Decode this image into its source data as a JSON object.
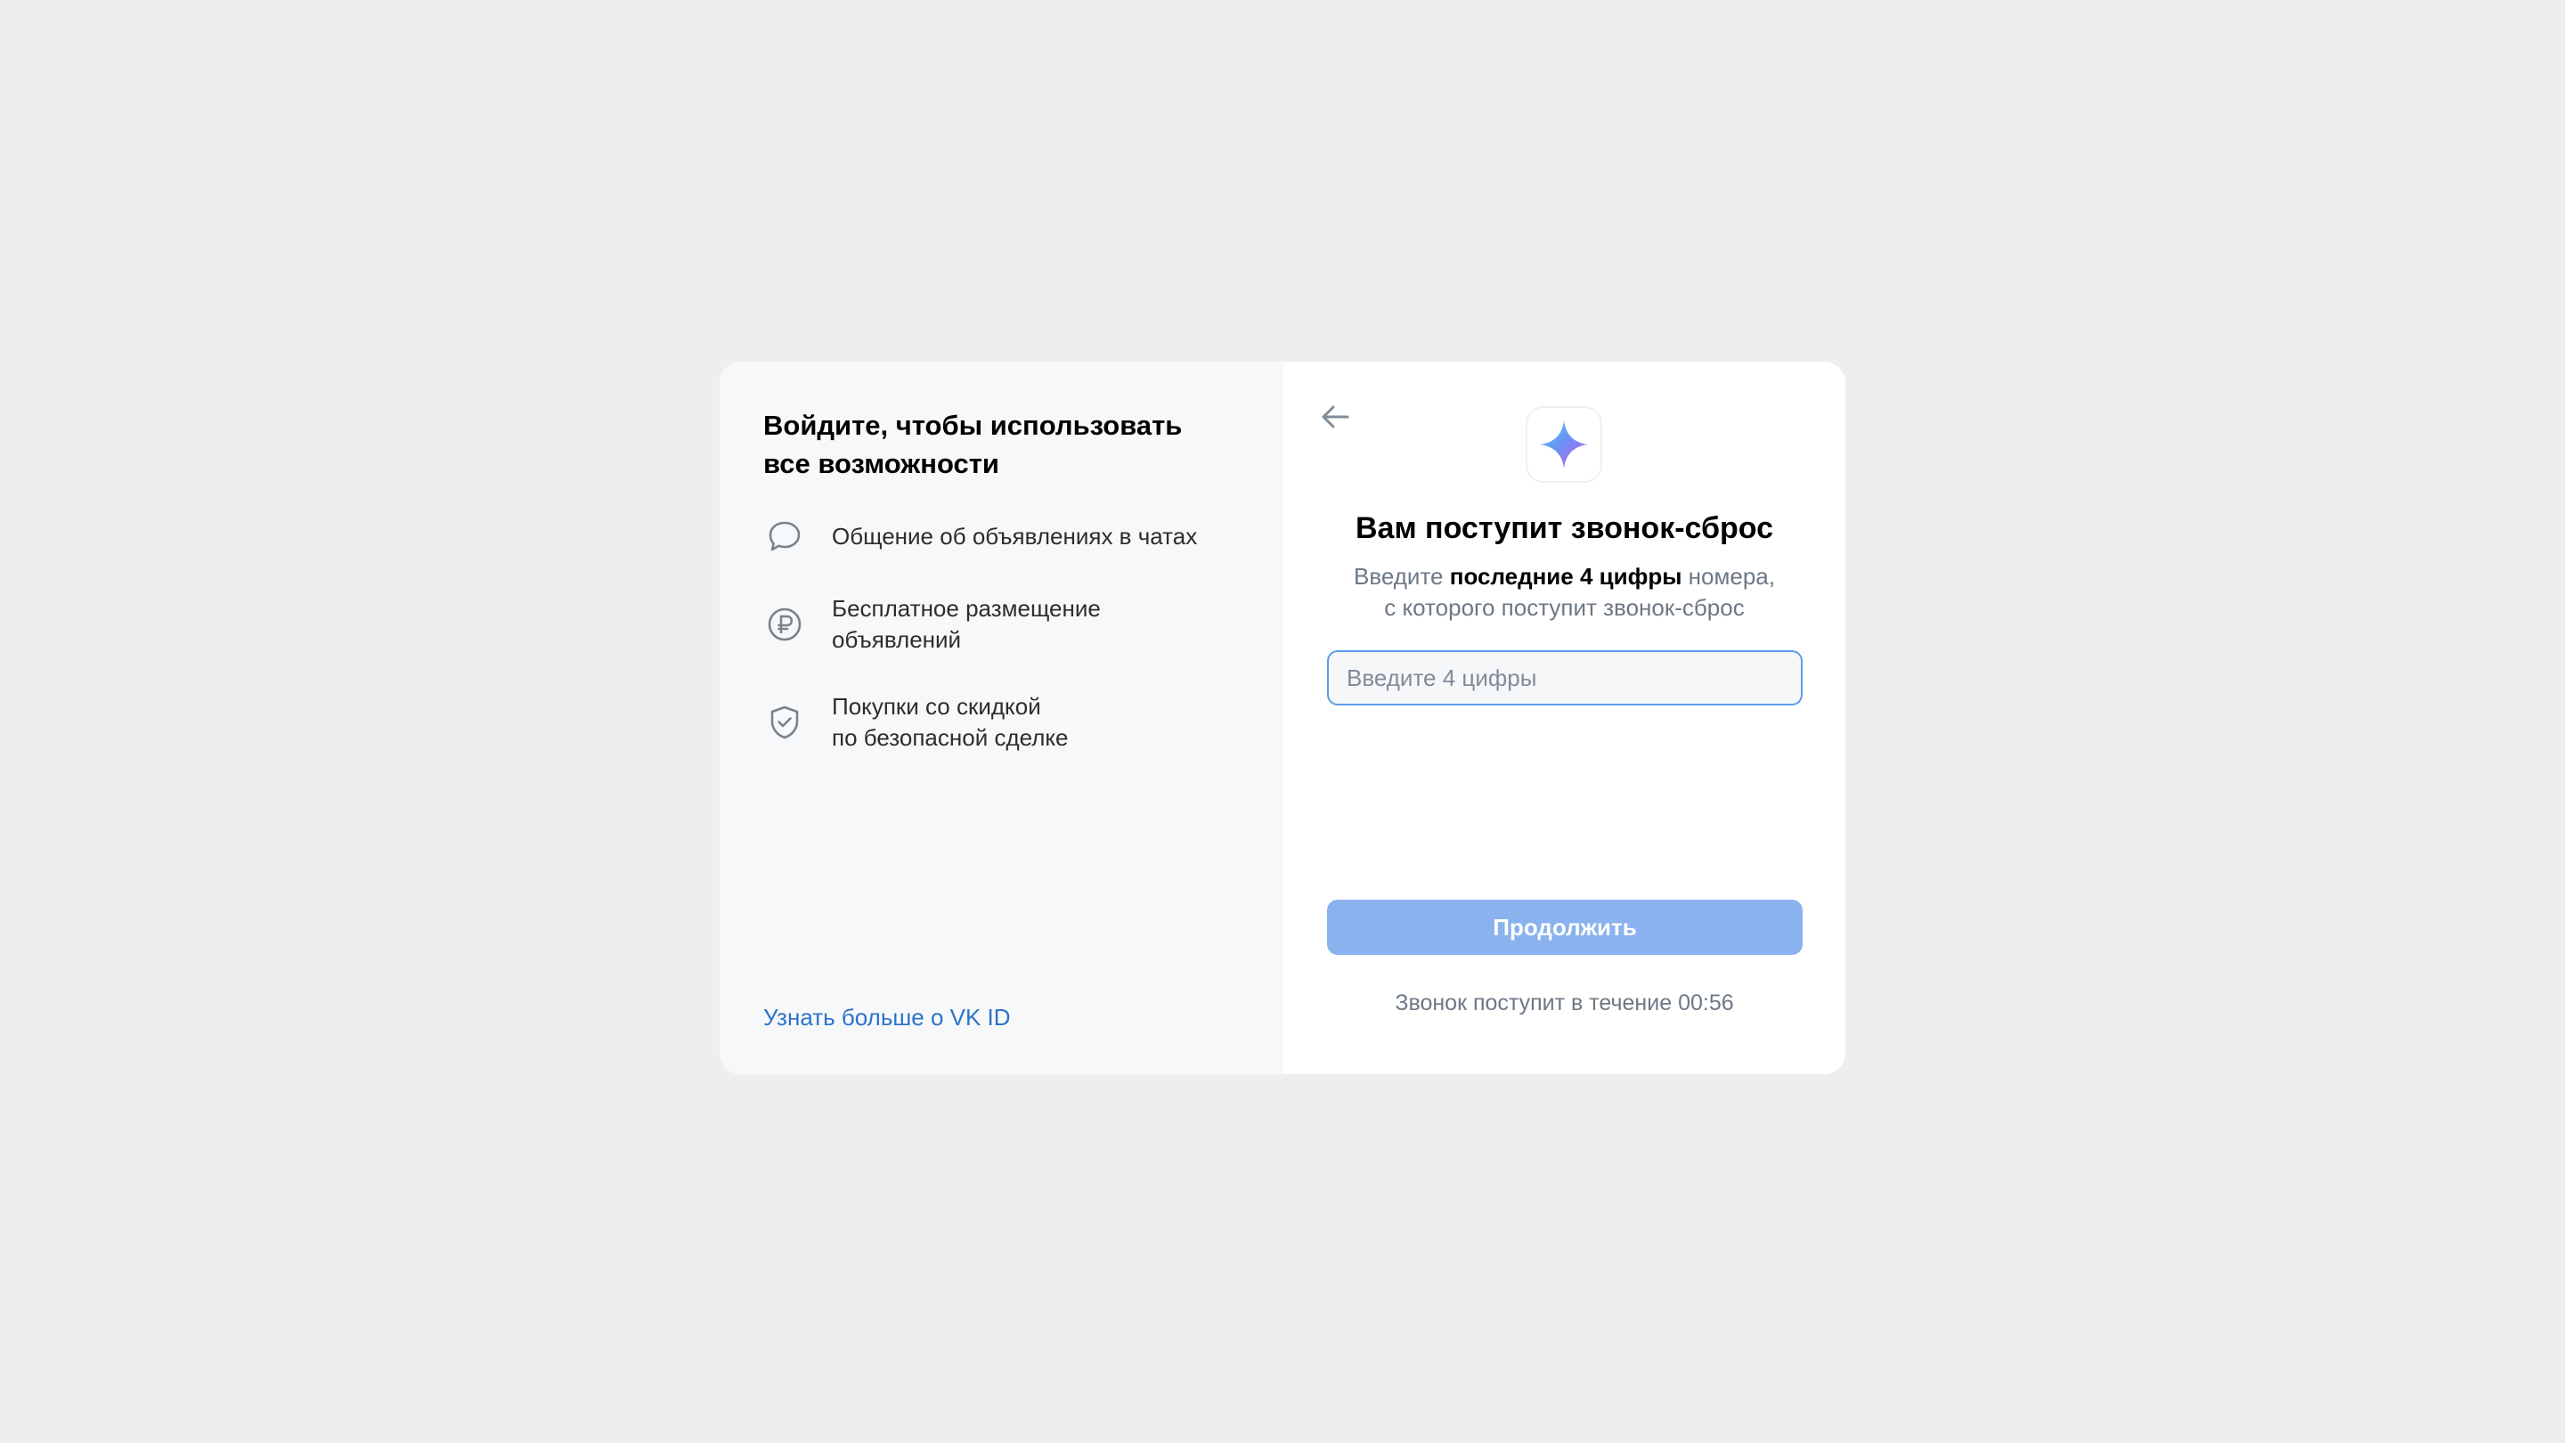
{
  "left_panel": {
    "title": "Войдите, чтобы использовать все возможности",
    "features": [
      {
        "icon": "chat-bubble-icon",
        "text": "Общение об объявлениях в чатах"
      },
      {
        "icon": "ruble-coin-icon",
        "text": "Бесплатное размещение\nобъявлений"
      },
      {
        "icon": "shield-check-icon",
        "text": "Покупки со скидкой\nпо безопасной сделке"
      }
    ],
    "learn_more_link": "Узнать больше о VK ID"
  },
  "right_panel": {
    "back_icon": "arrow-left-icon",
    "logo_icon": "sparkle-star-icon",
    "title": "Вам поступит звонок-сброс",
    "subtitle_prefix": "Введите ",
    "subtitle_bold": "последние 4 цифры",
    "subtitle_suffix": " номера,",
    "subtitle_line2": "с которого поступит звонок-сброс",
    "code_input": {
      "value": "",
      "placeholder": "Введите 4 цифры"
    },
    "continue_button": "Продолжить",
    "timer_label": "Звонок поступит в течение",
    "timer_value": "00:56"
  },
  "colors": {
    "background": "#edeef0",
    "panel_left": "#f7f8fa",
    "accent_link": "#2d73c8",
    "button_disabled": "#89b2ef",
    "input_border": "#5c9ce6"
  }
}
